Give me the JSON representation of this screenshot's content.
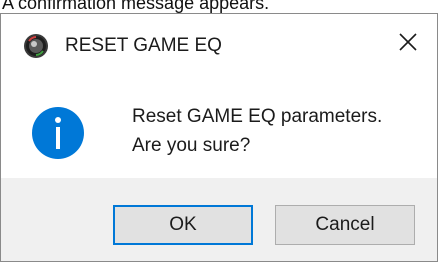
{
  "caption": "A confirmation message appears.",
  "dialog": {
    "title": "RESET GAME EQ",
    "close_icon": "close-icon",
    "app_icon": "app-icon",
    "info_icon": "info-icon",
    "message_line1": "Reset GAME EQ parameters.",
    "message_line2": "Are you sure?",
    "ok_label": "OK",
    "cancel_label": "Cancel"
  },
  "colors": {
    "info_blue": "#0078d7",
    "focus_border": "#0078d7",
    "footer_bg": "#f0f0f0",
    "button_bg": "#e1e1e1"
  }
}
